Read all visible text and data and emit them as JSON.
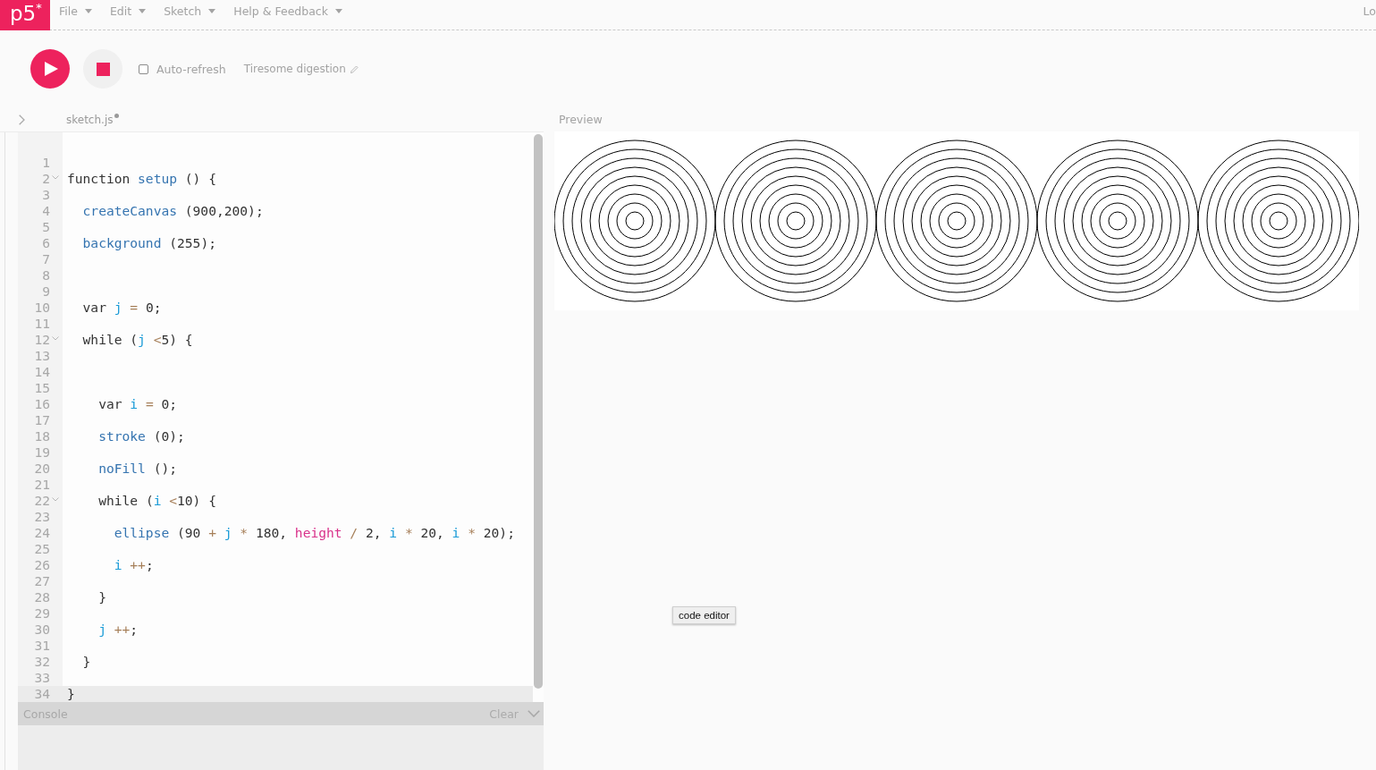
{
  "menu_bar": {
    "logo": "p5$^{*}$",
    "items": [
      "File",
      "Edit",
      "Sketch",
      "Help & Feedback"
    ],
    "account": "Lo"
  },
  "toolbar": {
    "auto_refresh": {
      "label": "Auto-refresh",
      "checked": false
    },
    "sketch_name": "Tiresome digestion"
  },
  "editor": {
    "file_tab": {
      "label": "sketch.js",
      "unsaved": true
    },
    "lines": [
      {
        "number": "1",
        "fold": false,
        "active": false
      },
      {
        "number": "2",
        "fold": true,
        "active": false,
        "tokens": [
          {
            "kind": "keyword",
            "text": "function"
          },
          {
            "kind": "def",
            "text": " setup"
          },
          {
            "kind": "plain",
            "text": " () {"
          }
        ]
      },
      {
        "number": "3",
        "fold": false,
        "active": false
      },
      {
        "number": "4",
        "fold": false,
        "active": false,
        "tokens": [
          {
            "kind": "builtin",
            "text": "  createCanvas"
          },
          {
            "kind": "plain",
            "text": " (900,200);"
          }
        ]
      },
      {
        "number": "5",
        "fold": false,
        "active": false
      },
      {
        "number": "6",
        "fold": false,
        "active": false,
        "tokens": [
          {
            "kind": "builtin",
            "text": "  background"
          },
          {
            "kind": "plain",
            "text": " (255);"
          }
        ]
      },
      {
        "number": "7",
        "fold": false,
        "active": false
      },
      {
        "number": "8",
        "fold": false,
        "active": false
      },
      {
        "number": "9",
        "fold": false,
        "active": false
      },
      {
        "number": "10",
        "fold": false,
        "active": false,
        "tokens": [
          {
            "kind": "keyword",
            "text": "  var"
          },
          {
            "kind": "variable",
            "text": " j"
          },
          {
            "kind": "operator",
            "text": " ="
          },
          {
            "kind": "plain",
            "text": " 0;"
          }
        ]
      },
      {
        "number": "11",
        "fold": false,
        "active": false
      },
      {
        "number": "12",
        "fold": true,
        "active": false,
        "tokens": [
          {
            "kind": "keyword",
            "text": "  while"
          },
          {
            "kind": "plain",
            "text": " ("
          },
          {
            "kind": "variable",
            "text": "j"
          },
          {
            "kind": "operator",
            "text": " <"
          },
          {
            "kind": "plain",
            "text": "5) {"
          }
        ]
      },
      {
        "number": "13",
        "fold": false,
        "active": false
      },
      {
        "number": "14",
        "fold": false,
        "active": false
      },
      {
        "number": "15",
        "fold": false,
        "active": false
      },
      {
        "number": "16",
        "fold": false,
        "active": false,
        "tokens": [
          {
            "kind": "keyword",
            "text": "    var"
          },
          {
            "kind": "variable",
            "text": " i"
          },
          {
            "kind": "operator",
            "text": " ="
          },
          {
            "kind": "plain",
            "text": " 0;"
          }
        ]
      },
      {
        "number": "17",
        "fold": false,
        "active": false
      },
      {
        "number": "18",
        "fold": false,
        "active": false,
        "tokens": [
          {
            "kind": "builtin",
            "text": "    stroke"
          },
          {
            "kind": "plain",
            "text": " (0);"
          }
        ]
      },
      {
        "number": "19",
        "fold": false,
        "active": false
      },
      {
        "number": "20",
        "fold": false,
        "active": false,
        "tokens": [
          {
            "kind": "builtin",
            "text": "    noFill"
          },
          {
            "kind": "plain",
            "text": " ();"
          }
        ]
      },
      {
        "number": "21",
        "fold": false,
        "active": false
      },
      {
        "number": "22",
        "fold": true,
        "active": false,
        "tokens": [
          {
            "kind": "keyword",
            "text": "    while"
          },
          {
            "kind": "plain",
            "text": " ("
          },
          {
            "kind": "variable",
            "text": "i"
          },
          {
            "kind": "operator",
            "text": " <"
          },
          {
            "kind": "plain",
            "text": "10) {"
          }
        ]
      },
      {
        "number": "23",
        "fold": false,
        "active": false
      },
      {
        "number": "24",
        "fold": false,
        "active": false,
        "tokens": [
          {
            "kind": "builtin",
            "text": "      ellipse"
          },
          {
            "kind": "plain",
            "text": " (90"
          },
          {
            "kind": "operator",
            "text": " +"
          },
          {
            "kind": "variable",
            "text": " j"
          },
          {
            "kind": "operator",
            "text": " *"
          },
          {
            "kind": "plain",
            "text": " 180,"
          },
          {
            "kind": "property",
            "text": " height"
          },
          {
            "kind": "operator",
            "text": " /"
          },
          {
            "kind": "plain",
            "text": " 2,"
          },
          {
            "kind": "variable",
            "text": " i"
          },
          {
            "kind": "operator",
            "text": " *"
          },
          {
            "kind": "plain",
            "text": " 20,"
          },
          {
            "kind": "variable",
            "text": " i"
          },
          {
            "kind": "operator",
            "text": " *"
          },
          {
            "kind": "plain",
            "text": " 20);"
          }
        ]
      },
      {
        "number": "25",
        "fold": false,
        "active": false
      },
      {
        "number": "26",
        "fold": false,
        "active": false,
        "tokens": [
          {
            "kind": "variable",
            "text": "      i"
          },
          {
            "kind": "operator",
            "text": " ++"
          },
          {
            "kind": "plain",
            "text": ";"
          }
        ]
      },
      {
        "number": "27",
        "fold": false,
        "active": false
      },
      {
        "number": "28",
        "fold": false,
        "active": false,
        "tokens": [
          {
            "kind": "plain",
            "text": "    }"
          }
        ]
      },
      {
        "number": "29",
        "fold": false,
        "active": false
      },
      {
        "number": "30",
        "fold": false,
        "active": false,
        "tokens": [
          {
            "kind": "variable",
            "text": "    j"
          },
          {
            "kind": "operator",
            "text": " ++"
          },
          {
            "kind": "plain",
            "text": ";"
          }
        ]
      },
      {
        "number": "31",
        "fold": false,
        "active": false
      },
      {
        "number": "32",
        "fold": false,
        "active": false,
        "tokens": [
          {
            "kind": "plain",
            "text": "  }"
          }
        ]
      },
      {
        "number": "33",
        "fold": false,
        "active": false
      },
      {
        "number": "34",
        "fold": false,
        "active": true,
        "tokens": [
          {
            "kind": "plain",
            "text": "}"
          }
        ]
      }
    ]
  },
  "console": {
    "title": "Console",
    "clear": "Clear"
  },
  "preview": {
    "title": "Preview"
  },
  "tooltip": "code editor"
}
